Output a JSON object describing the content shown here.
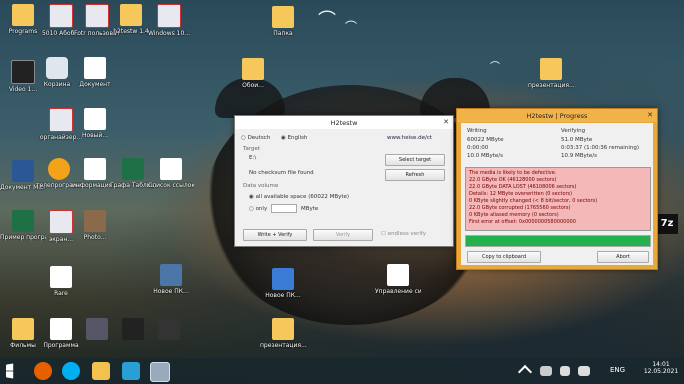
{
  "desktop": {
    "icons": [
      {
        "label": "Programs"
      },
      {
        "label": "5010 Абоб..."
      },
      {
        "label": "Fotr пользоват..."
      },
      {
        "label": "h2testw 1.4"
      },
      {
        "label": "Windows 10..."
      },
      {
        "label": "Папка"
      },
      {
        "label": "Video 1..."
      },
      {
        "label": "Корзина"
      },
      {
        "label": "Документ"
      },
      {
        "label": "органайзер..."
      },
      {
        "label": "Новый..."
      },
      {
        "label": "программа 2010 Рабо..."
      },
      {
        "label": "Документ Microsoft..."
      },
      {
        "label": "телепрограмма..."
      },
      {
        "label": "информация..."
      },
      {
        "label": "Графа Таблица..."
      },
      {
        "label": "Список ссылок..."
      },
      {
        "label": "Пример программ..."
      },
      {
        "label": "экран..."
      },
      {
        "label": "Photo..."
      },
      {
        "label": "Новое ПК..."
      },
      {
        "label": "Управление системой..."
      },
      {
        "label": "Фильмы"
      },
      {
        "label": "Программа"
      },
      {
        "label": "Rare"
      },
      {
        "label": "Обои..."
      },
      {
        "label": "презентация..."
      }
    ]
  },
  "h2testw_main": {
    "title": "H2testw",
    "lang_german": "Deutsch",
    "lang_english": "English",
    "website": "www.heise.de/ct",
    "target_label": "Target",
    "target_value": "E:\\",
    "no_checksum": "No checksum file found",
    "select_target": "Select target",
    "refresh": "Refresh",
    "data_volume": "Data volume",
    "all_space": "all available space (60022 MByte)",
    "only": "only",
    "mbyte": "MByte",
    "write_verify": "Write + Verify",
    "verify": "Verify",
    "endless": "endless verify"
  },
  "h2testw_progress": {
    "title": "H2testw | Progress",
    "writing": "Writing",
    "verifying": "Verifying",
    "w_size": "60022 MByte",
    "w_time": "0:00:00",
    "w_rate": "10.0 MByte/s",
    "v_size": "51.0 MByte",
    "v_time": "0:03:37 (1:00:36 remaining)",
    "v_rate": "10.9 MByte/s",
    "log": [
      "The media is likely to be defective.",
      "22.0 GByte OK (46128000 sectors)",
      "22.0 GByte DATA LOST (46108006 sectors)",
      "Details: 12 MByte overwritten (0 sectors)",
      "0 KByte slightly changed (< 8 bit/sector, 0 sectors)",
      "22.0 GByte corrupted (1765560 sectors)",
      "0 KByte aliased memory (0 sectors)",
      "First error at offset: 0x0000000580000000"
    ],
    "progress": 1.0,
    "copy_clipboard": "Copy to clipboard",
    "abort": "Abort"
  },
  "taskbar": {
    "lang": "ENG",
    "time": "14:01",
    "date": "12.05.2021"
  },
  "colors": {
    "progress_fill": "#22b14c",
    "log_bg": "#f4b8b8",
    "progress_frame": "#e8a83a"
  }
}
